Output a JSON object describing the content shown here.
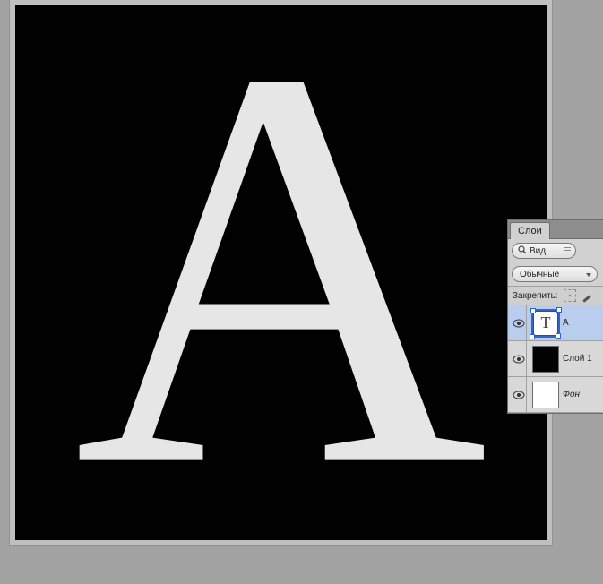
{
  "canvas": {
    "letter": "A",
    "letter_color": "#e6e6e6",
    "bg_color": "#010101"
  },
  "panel": {
    "tab_label": "Слои",
    "view_select": {
      "label": "Вид",
      "icon": "magnifier-icon"
    },
    "blend_select": {
      "label": "Обычные"
    },
    "lock_label": "Закрепить:",
    "layers": [
      {
        "name": "A",
        "type": "text",
        "selected": true,
        "visible": true,
        "italic": false
      },
      {
        "name": "Слой 1",
        "type": "black",
        "selected": false,
        "visible": true,
        "italic": false
      },
      {
        "name": "Фон",
        "type": "white",
        "selected": false,
        "visible": true,
        "italic": true
      }
    ]
  }
}
